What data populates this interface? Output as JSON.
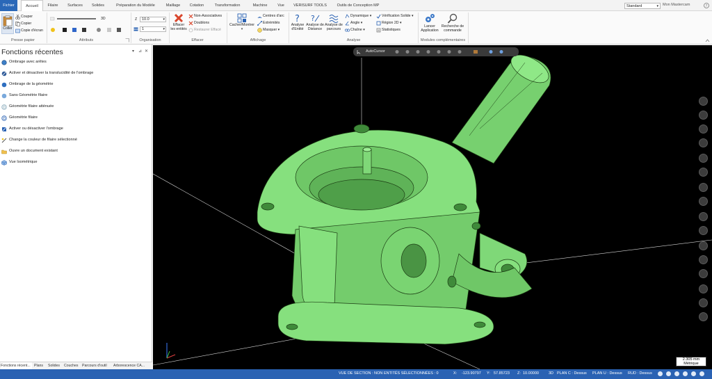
{
  "tabs": [
    {
      "label": "Fichier"
    },
    {
      "label": "Accueil"
    },
    {
      "label": "Filaire"
    },
    {
      "label": "Surfaces"
    },
    {
      "label": "Solides"
    },
    {
      "label": "Préparation du Modèle"
    },
    {
      "label": "Maillage"
    },
    {
      "label": "Cotation"
    },
    {
      "label": "Transformation"
    },
    {
      "label": "Machine"
    },
    {
      "label": "Vue"
    },
    {
      "label": "VERISURF TOOLS"
    },
    {
      "label": "Outils de Conception MP"
    }
  ],
  "header": {
    "layout_select": "Standard",
    "user": "Mon Mastercam"
  },
  "ribbon": {
    "clipboard": {
      "paste": "Coller",
      "cut": "Couper",
      "copy": "Copier",
      "screen_copy": "Copie d'écran",
      "group": "Presse papier"
    },
    "attributes": {
      "mode3d": "3D",
      "group": "Attributs"
    },
    "organisation": {
      "z_label": "Z",
      "z_value": "10.0",
      "level_value": "1",
      "group": "Organisation"
    },
    "delete": {
      "erase": "Effacer les entités",
      "non_assoc": "Non-Associatives",
      "duplicates": "Doublons",
      "restore": "Restaurer Effacé",
      "group": "Effacer"
    },
    "display": {
      "hide_show": "Cacher/Montrer",
      "arc_centers": "Centres d'arc",
      "endpoints": "Extrémités",
      "mask": "Masquer",
      "group": "Affichage"
    },
    "analysis": {
      "entity": "Analyse d'Entité",
      "distance": "Analyse de Distance",
      "toolpath": "Analyse de parcours",
      "dynamic": "Dynamique",
      "angle": "Angle",
      "chain": "Chaîne",
      "solid_check": "Vérification Solide",
      "region2d": "Région 2D",
      "stats": "Statistiques",
      "group": "Analyse"
    },
    "addins": {
      "launch": "Lancer Application",
      "search": "Recherche de commande",
      "group": "Modules complémentaires"
    }
  },
  "panel": {
    "title": "Fonctions récentes",
    "items": [
      {
        "label": "Ombrage avec arêtes",
        "icon": "shade-edges-icon"
      },
      {
        "label": "Activer et désactiver la translucidité de l'ombrage",
        "icon": "translucency-icon"
      },
      {
        "label": "Ombrage de la géométrie",
        "icon": "shade-icon"
      },
      {
        "label": "Sans Géométrie filaire",
        "icon": "no-wireframe-icon"
      },
      {
        "label": "Géométrie filaire atténuée",
        "icon": "dim-wireframe-icon"
      },
      {
        "label": "Géométrie filaire",
        "icon": "wireframe-icon"
      },
      {
        "label": "Activer ou désactiver l'ombrage",
        "icon": "toggle-shade-icon"
      },
      {
        "label": "Change la couleur de filaire sélectionné",
        "icon": "wire-color-icon"
      },
      {
        "label": "Ouvre un document existant",
        "icon": "open-folder-icon"
      },
      {
        "label": "Vue Isométrique",
        "icon": "isometric-view-icon"
      }
    ],
    "tabs": [
      {
        "label": "Fonctions récent..."
      },
      {
        "label": "Plans"
      },
      {
        "label": "Solides"
      },
      {
        "label": "Couches"
      },
      {
        "label": "Parcours d'outil"
      },
      {
        "label": "Arborescence CA..."
      }
    ]
  },
  "viewport": {
    "autocursor": "AutoCursor",
    "scale_value": "2.305 mm",
    "scale_unit": "Métrique"
  },
  "status": {
    "section": "VUE DE SECTION : NON",
    "selected": "ENTITÉS SÉLECTIONNÉES : 0",
    "x_label": "X:",
    "x": "-123.90797",
    "y_label": "Y:",
    "y": "57.85723",
    "z_label": "Z:",
    "z": "10.00000",
    "mode": "3D",
    "plan_c": "PLAN C : Dessus",
    "plan_u": "PLAN U : Dessus",
    "rud": "RUD : Dessus"
  },
  "colors": {
    "accent": "#2a62b3",
    "model": "#7fe07a",
    "viewport_bg": "#000000"
  }
}
